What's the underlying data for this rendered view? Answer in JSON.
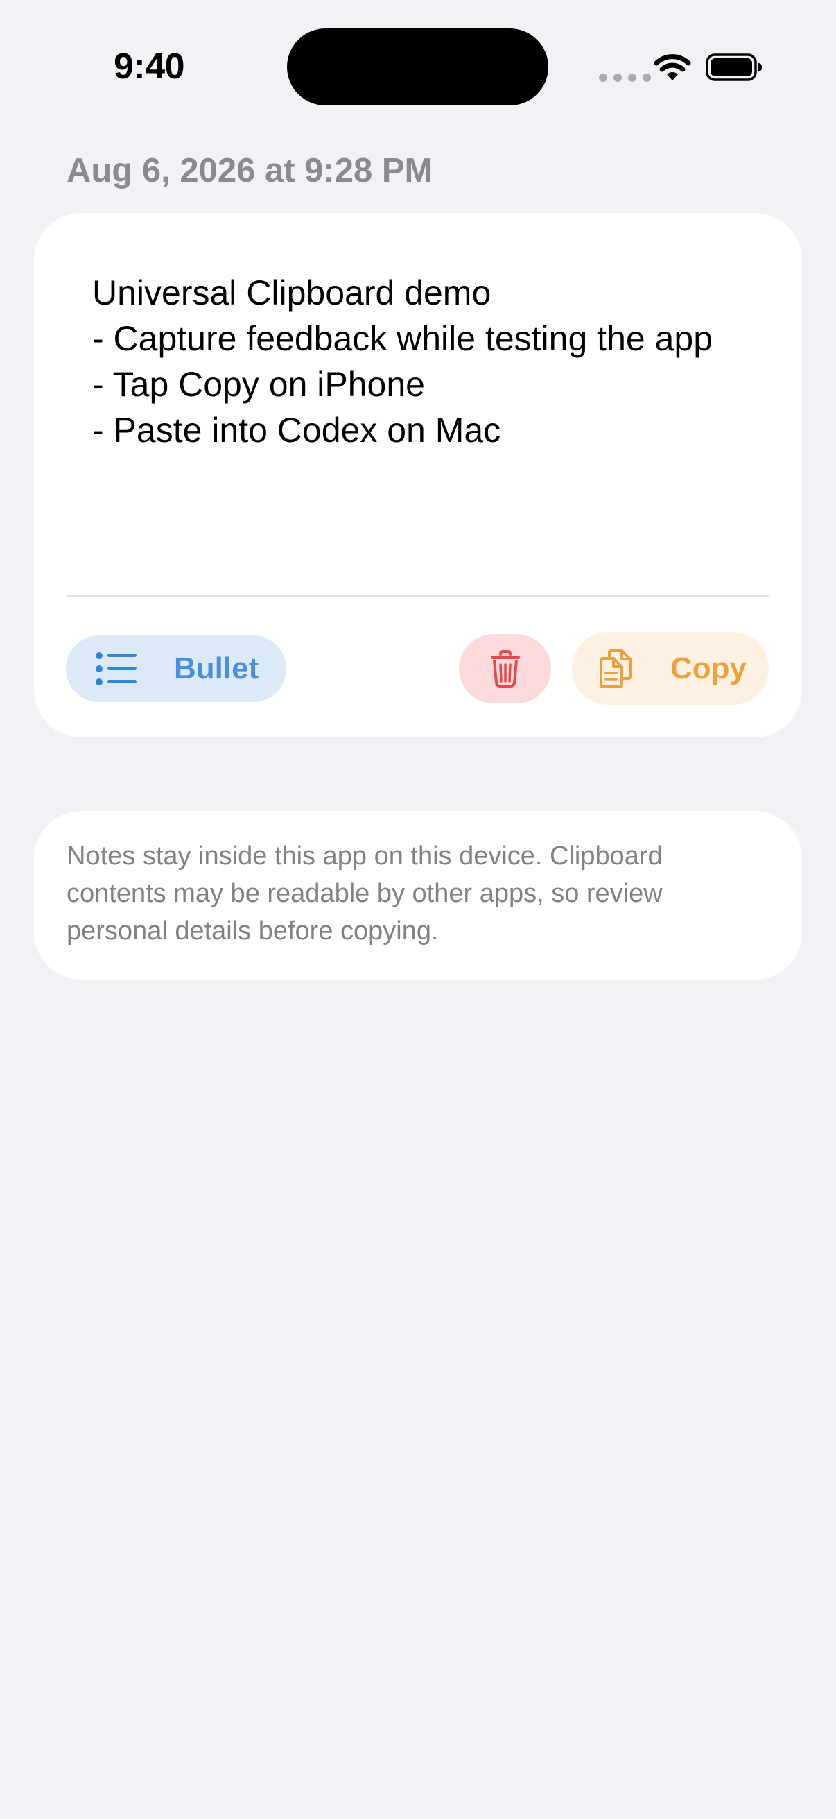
{
  "status_bar": {
    "time": "9:40"
  },
  "note": {
    "date": "Aug 6, 2026 at 9:28 PM",
    "body": "Universal Clipboard demo\n- Capture feedback while testing the app\n- Tap Copy on iPhone\n- Paste into Codex on Mac",
    "actions": {
      "bullet_label": "Bullet",
      "copy_label": "Copy"
    }
  },
  "privacy_notice": {
    "text": "Notes stay inside this app on this device. Clipboard contents may be readable by other apps, so review personal details before copying."
  },
  "icons": {
    "bullet": "list-bullet-icon",
    "delete": "trash-icon",
    "copy": "doc-on-doc-icon",
    "wifi": "wifi-icon",
    "battery": "battery-icon"
  },
  "colors": {
    "background": "#F1F1F6",
    "card": "#FFFFFF",
    "bullet_accent": "#4A90D4",
    "bullet_bg": "#DCEAF8",
    "delete_accent": "#E5484D",
    "delete_bg": "#FCDADB",
    "copy_accent": "#E9A23D",
    "copy_bg": "#FEF1E2",
    "secondary_text": "#8A8A8F"
  }
}
